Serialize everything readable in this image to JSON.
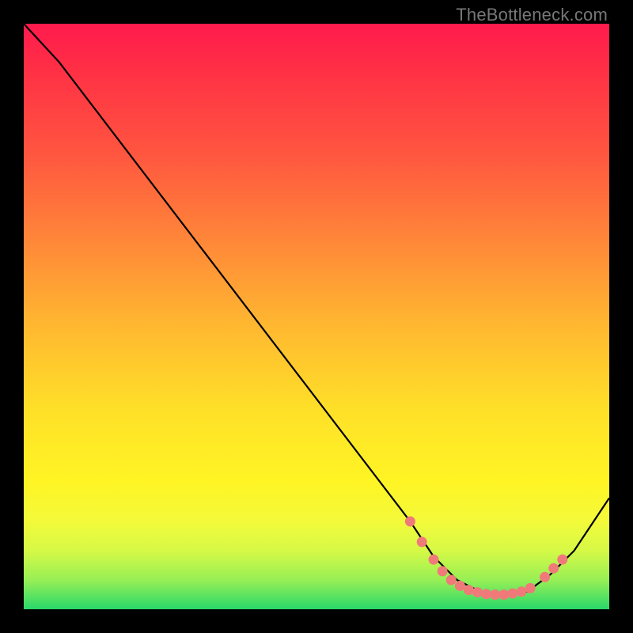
{
  "watermark": "TheBottleneck.com",
  "chart_data": {
    "type": "line",
    "title": "",
    "xlabel": "",
    "ylabel": "",
    "xlim": [
      0,
      100
    ],
    "ylim": [
      0,
      100
    ],
    "grid": false,
    "legend": false,
    "curve": [
      {
        "x": 0,
        "y": 100
      },
      {
        "x": 6,
        "y": 93.5
      },
      {
        "x": 66,
        "y": 15
      },
      {
        "x": 70,
        "y": 9
      },
      {
        "x": 74,
        "y": 5
      },
      {
        "x": 78,
        "y": 3
      },
      {
        "x": 82,
        "y": 2.5
      },
      {
        "x": 86,
        "y": 3
      },
      {
        "x": 90,
        "y": 6
      },
      {
        "x": 94,
        "y": 10
      },
      {
        "x": 100,
        "y": 19
      }
    ],
    "highlight_points": [
      {
        "x": 66,
        "y": 15
      },
      {
        "x": 68,
        "y": 11.5
      },
      {
        "x": 70,
        "y": 8.5
      },
      {
        "x": 71.5,
        "y": 6.5
      },
      {
        "x": 73,
        "y": 5
      },
      {
        "x": 74.5,
        "y": 4
      },
      {
        "x": 76,
        "y": 3.3
      },
      {
        "x": 77.5,
        "y": 2.9
      },
      {
        "x": 79,
        "y": 2.6
      },
      {
        "x": 80.5,
        "y": 2.5
      },
      {
        "x": 82,
        "y": 2.5
      },
      {
        "x": 83.5,
        "y": 2.7
      },
      {
        "x": 85,
        "y": 3.0
      },
      {
        "x": 86.5,
        "y": 3.6
      },
      {
        "x": 89,
        "y": 5.5
      },
      {
        "x": 90.5,
        "y": 7
      },
      {
        "x": 92,
        "y": 8.5
      }
    ],
    "colors": {
      "line": "#000000",
      "dots": "#f07a7a",
      "gradient_top": "#ff1a4d",
      "gradient_bottom": "#28d86a"
    }
  }
}
